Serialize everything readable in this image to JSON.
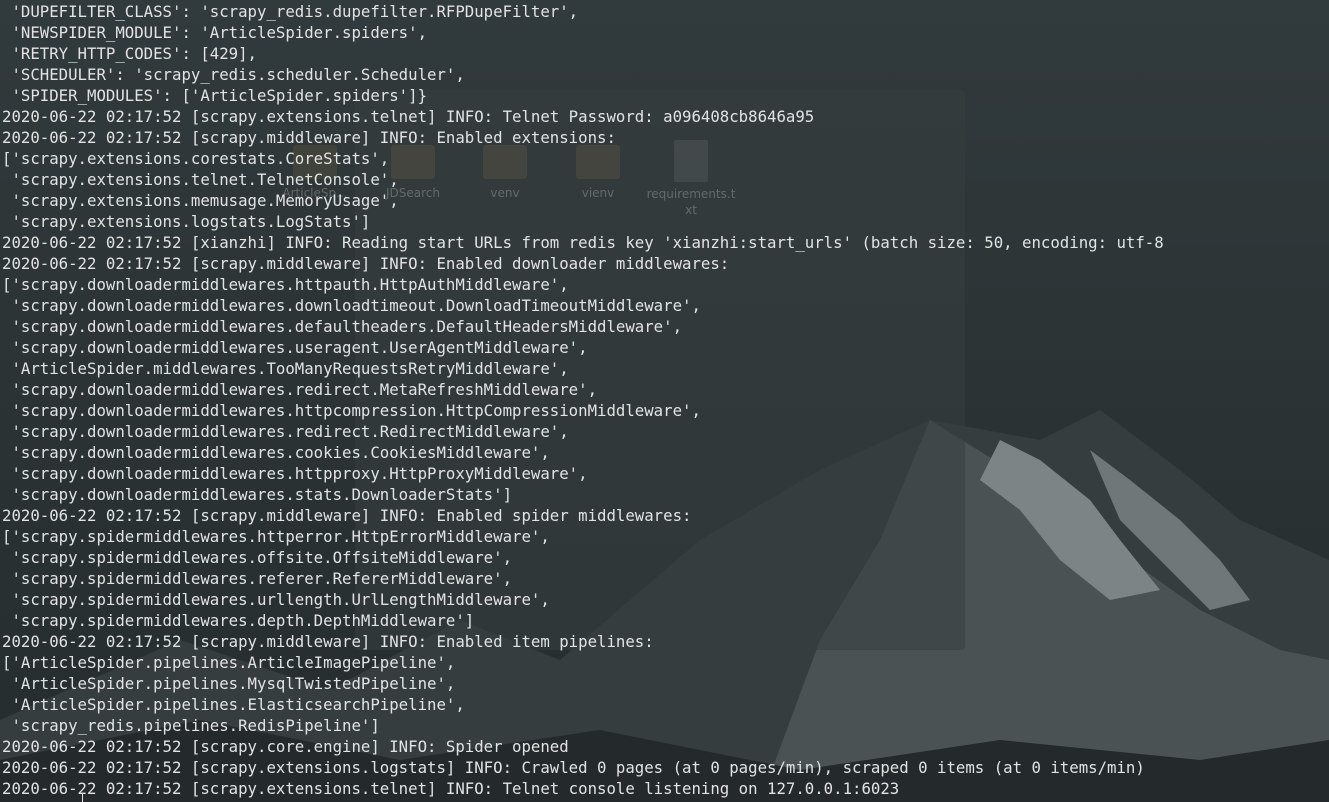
{
  "desktop": {
    "icons": [
      {
        "label": "ArticleSp...",
        "kind": "folder"
      },
      {
        "label": "JDSearch",
        "kind": "folder"
      },
      {
        "label": "venv",
        "kind": "folder"
      },
      {
        "label": "vienv",
        "kind": "folder"
      },
      {
        "label": "requirements.txt",
        "kind": "file"
      }
    ]
  },
  "terminal": {
    "lines": [
      " 'DUPEFILTER_CLASS': 'scrapy_redis.dupefilter.RFPDupeFilter',",
      " 'NEWSPIDER_MODULE': 'ArticleSpider.spiders',",
      " 'RETRY_HTTP_CODES': [429],",
      " 'SCHEDULER': 'scrapy_redis.scheduler.Scheduler',",
      " 'SPIDER_MODULES': ['ArticleSpider.spiders']}",
      "2020-06-22 02:17:52 [scrapy.extensions.telnet] INFO: Telnet Password: a096408cb8646a95",
      "2020-06-22 02:17:52 [scrapy.middleware] INFO: Enabled extensions:",
      "['scrapy.extensions.corestats.CoreStats',",
      " 'scrapy.extensions.telnet.TelnetConsole',",
      " 'scrapy.extensions.memusage.MemoryUsage',",
      " 'scrapy.extensions.logstats.LogStats']",
      "2020-06-22 02:17:52 [xianzhi] INFO: Reading start URLs from redis key 'xianzhi:start_urls' (batch size: 50, encoding: utf-8",
      "2020-06-22 02:17:52 [scrapy.middleware] INFO: Enabled downloader middlewares:",
      "['scrapy.downloadermiddlewares.httpauth.HttpAuthMiddleware',",
      " 'scrapy.downloadermiddlewares.downloadtimeout.DownloadTimeoutMiddleware',",
      " 'scrapy.downloadermiddlewares.defaultheaders.DefaultHeadersMiddleware',",
      " 'scrapy.downloadermiddlewares.useragent.UserAgentMiddleware',",
      " 'ArticleSpider.middlewares.TooManyRequestsRetryMiddleware',",
      " 'scrapy.downloadermiddlewares.redirect.MetaRefreshMiddleware',",
      " 'scrapy.downloadermiddlewares.httpcompression.HttpCompressionMiddleware',",
      " 'scrapy.downloadermiddlewares.redirect.RedirectMiddleware',",
      " 'scrapy.downloadermiddlewares.cookies.CookiesMiddleware',",
      " 'scrapy.downloadermiddlewares.httpproxy.HttpProxyMiddleware',",
      " 'scrapy.downloadermiddlewares.stats.DownloaderStats']",
      "2020-06-22 02:17:52 [scrapy.middleware] INFO: Enabled spider middlewares:",
      "['scrapy.spidermiddlewares.httperror.HttpErrorMiddleware',",
      " 'scrapy.spidermiddlewares.offsite.OffsiteMiddleware',",
      " 'scrapy.spidermiddlewares.referer.RefererMiddleware',",
      " 'scrapy.spidermiddlewares.urllength.UrlLengthMiddleware',",
      " 'scrapy.spidermiddlewares.depth.DepthMiddleware']",
      "2020-06-22 02:17:52 [scrapy.middleware] INFO: Enabled item pipelines:",
      "['ArticleSpider.pipelines.ArticleImagePipeline',",
      " 'ArticleSpider.pipelines.MysqlTwistedPipeline',",
      " 'ArticleSpider.pipelines.ElasticsearchPipeline',",
      " 'scrapy_redis.pipelines.RedisPipeline']",
      "2020-06-22 02:17:52 [scrapy.core.engine] INFO: Spider opened",
      "2020-06-22 02:17:52 [scrapy.extensions.logstats] INFO: Crawled 0 pages (at 0 pages/min), scraped 0 items (at 0 items/min)",
      "2020-06-22 02:17:52 [scrapy.extensions.telnet] INFO: Telnet console listening on 127.0.0.1:6023"
    ]
  },
  "colors": {
    "terminal_text": "#e3e3e3",
    "background": "#2a3032"
  }
}
